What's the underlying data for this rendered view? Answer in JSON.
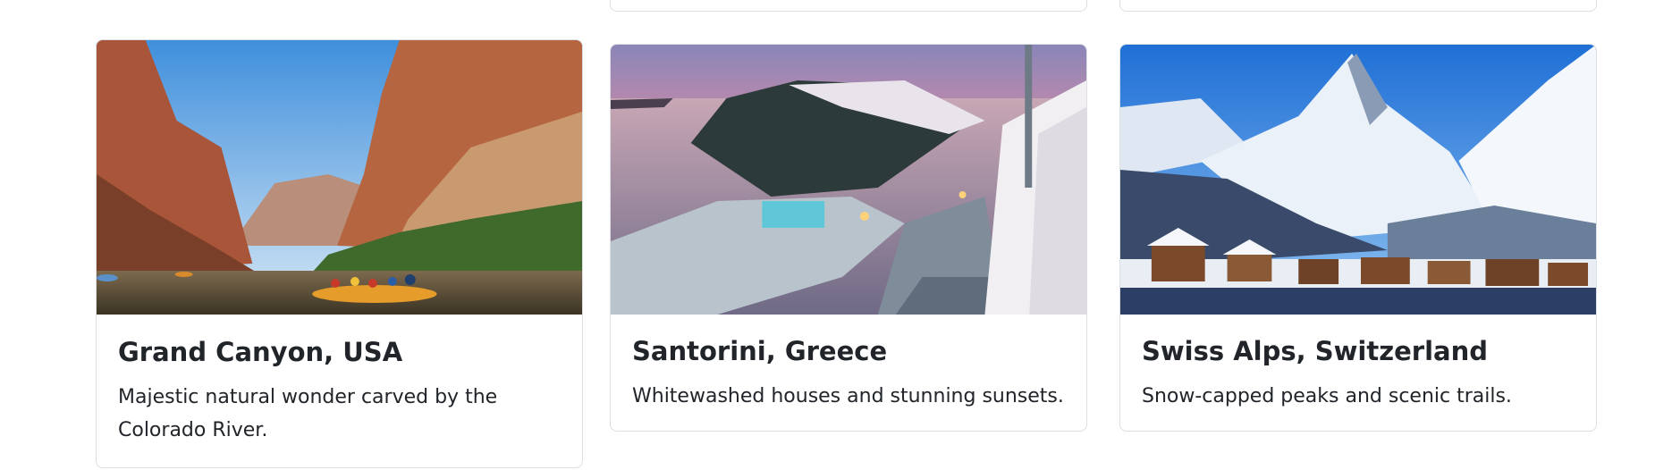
{
  "cards": [
    {
      "title": "Grand Canyon, USA",
      "description": "Majestic natural wonder carved by the Colorado River.",
      "image_icon": "grand-canyon-photo"
    },
    {
      "title": "Santorini, Greece",
      "description": "Whitewashed houses and stunning sunsets.",
      "image_icon": "santorini-photo"
    },
    {
      "title": "Swiss Alps, Switzerland",
      "description": "Snow-capped peaks and scenic trails.",
      "image_icon": "swiss-alps-photo"
    }
  ],
  "colors": {
    "card_border": "#dcdfe3",
    "text": "#212529"
  }
}
